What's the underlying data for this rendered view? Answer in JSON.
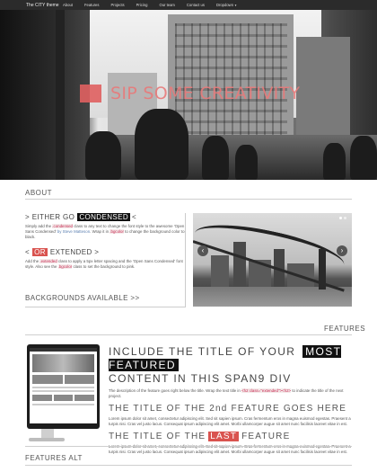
{
  "navbar": {
    "brand": "The CITY theme",
    "items": [
      "About",
      "Features",
      "Projects",
      "Pricing",
      "Our team",
      "Contact us",
      "Dropdown"
    ]
  },
  "hero": {
    "title": "SIP SOME CREATIVITY"
  },
  "about": {
    "heading": "ABOUT",
    "either_go": "> EITHER GO",
    "condensed": "CONDENSED",
    "close_bracket": "<",
    "p1_a": "Simply add the",
    "p1_code1": ".condensed",
    "p1_b": "class to any text to change the font style to the awesome 'Open Sans Condensed'",
    "p1_link": "by Steve Matteson",
    "p1_c": ". Wrap it in",
    "p1_code2": ".bgcolor",
    "p1_d": "to change the background color to black.",
    "or_prefix": "<",
    "or": "OR",
    "extended": "EXTENDED >",
    "p2_a": "Add the",
    "p2_code1": ".extended",
    "p2_b": "class to apply a 5px letter spacing and the 'Open Sans Condensed' font style. Also see the",
    "p2_code2": ".bgcolor",
    "p2_c": "class to set the background to pink.",
    "backgrounds": "BACKGROUNDS AVAILABLE >>"
  },
  "features": {
    "heading": "FEATURES",
    "h1_a": "INCLUDE THE TITLE OF YOUR",
    "h1_hl": "MOST FEATURED",
    "h1_b": "CONTENT IN THIS SPAN9 DIV",
    "p1_a": "The description of the feature goes right below the title. Wrap the text title in",
    "p1_code": "<h2 class=\"extended\"><h2>",
    "p1_b": "to indicate the title of the next project.",
    "h2": "THE TITLE OF THE 2nd FEATURE GOES HERE",
    "p2": "Lorem ipsum dolor sit amet, consectetur adipiscing elit. Sed sit sapien ipsum. Cras fermentum eros in magna euismod egestas. Praesent a turpis nisi. Cras vel justo lacus. Consequat ipsum adipiscing elit amet. Morbi ullamcorper augue sit amet nunc facilisis laoreet vitae in est.",
    "h3_a": "THE TITLE OF THE",
    "h3_hl": "LAST",
    "h3_b": "FEATURE",
    "p3": "Lorem ipsum dolor sit amet, consectetur adipiscing elit. Sed sit sapien ipsum. Cras fermentum eros in magna euismod egestas. Praesent a turpis nisi. Cras vel justo lacus. Consequat ipsum adipiscing elit amet. Morbi ullamcorper augue sit amet nunc facilisis laoreet vitae in est."
  },
  "features_alt": {
    "heading": "FEATURES ALT"
  },
  "carousel": {
    "prev": "‹",
    "next": "›",
    "slides": 2,
    "active": 0
  },
  "colors": {
    "accent": "#d9534f",
    "navbar": "#2b2b2b",
    "dark_highlight": "#111111"
  }
}
